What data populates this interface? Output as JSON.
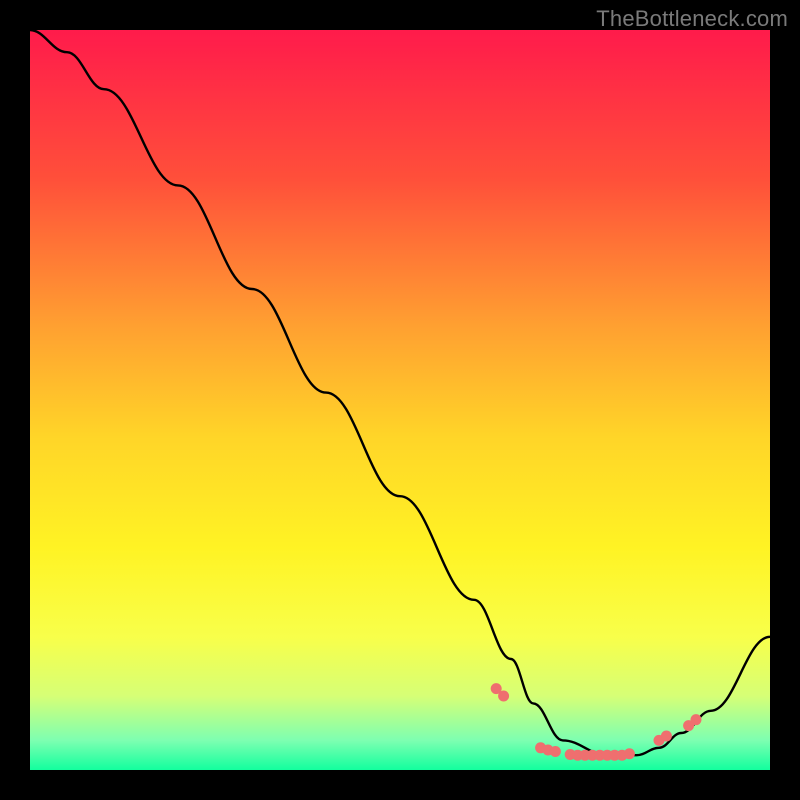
{
  "watermark": "TheBottleneck.com",
  "chart_data": {
    "type": "line",
    "title": "",
    "xlabel": "",
    "ylabel": "",
    "xlim": [
      0,
      100
    ],
    "ylim": [
      0,
      100
    ],
    "grid": false,
    "legend": false,
    "gradient_stops": [
      {
        "offset": 0.0,
        "color": "#ff1b4b"
      },
      {
        "offset": 0.2,
        "color": "#ff4f3a"
      },
      {
        "offset": 0.4,
        "color": "#ffa031"
      },
      {
        "offset": 0.55,
        "color": "#ffd528"
      },
      {
        "offset": 0.7,
        "color": "#fff324"
      },
      {
        "offset": 0.82,
        "color": "#f8ff4a"
      },
      {
        "offset": 0.9,
        "color": "#d6ff76"
      },
      {
        "offset": 0.96,
        "color": "#7dffb1"
      },
      {
        "offset": 1.0,
        "color": "#12ff9e"
      }
    ],
    "series": [
      {
        "name": "curve",
        "stroke": "#000000",
        "x": [
          0,
          5,
          10,
          20,
          30,
          40,
          50,
          60,
          65,
          68,
          72,
          78,
          82,
          85,
          88,
          92,
          100
        ],
        "values": [
          100,
          97,
          92,
          79,
          65,
          51,
          37,
          23,
          15,
          9,
          4,
          2,
          2,
          3,
          5,
          8,
          18
        ]
      }
    ],
    "markers": {
      "color": "#ef6f6f",
      "radius": 5.5,
      "x": [
        63,
        64,
        69,
        70,
        71,
        73,
        74,
        75,
        76,
        77,
        78,
        79,
        80,
        81,
        85,
        86,
        89,
        90
      ],
      "values": [
        11,
        10,
        3,
        2.7,
        2.5,
        2.1,
        2,
        2,
        2,
        2,
        2,
        2,
        2,
        2.2,
        4,
        4.6,
        6,
        6.8
      ]
    }
  }
}
